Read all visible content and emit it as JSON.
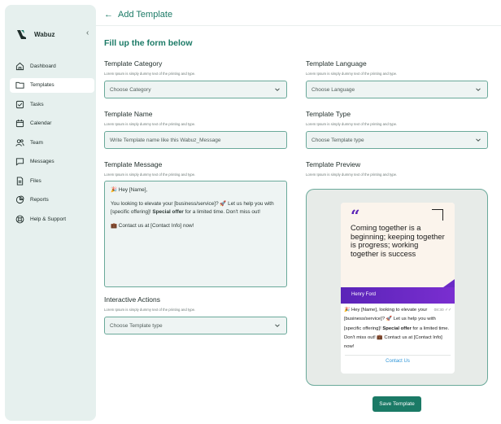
{
  "sidebar": {
    "brand": "Wabuz",
    "collapse_icon": "chevron-left-icon",
    "items": [
      {
        "label": "Dashboard",
        "icon": "home-icon"
      },
      {
        "label": "Templates",
        "icon": "folder-icon",
        "active": true
      },
      {
        "label": "Tasks",
        "icon": "checkbox-icon"
      },
      {
        "label": "Calendar",
        "icon": "calendar-icon"
      },
      {
        "label": "Team",
        "icon": "users-icon"
      },
      {
        "label": "Messages",
        "icon": "message-icon"
      },
      {
        "label": "Files",
        "icon": "file-icon"
      },
      {
        "label": "Reports",
        "icon": "pie-chart-icon"
      },
      {
        "label": "Help & Support",
        "icon": "lifebuoy-icon"
      }
    ]
  },
  "header": {
    "back_arrow": "←",
    "title": "Add Template"
  },
  "form": {
    "title": "Fill up the form below",
    "helper": "Lorem Ipsum is simply dummy text of the printing and type.",
    "category": {
      "label": "Template Category",
      "placeholder": "Choose Category"
    },
    "language": {
      "label": "Template Language",
      "placeholder": "Choose Language"
    },
    "name": {
      "label": "Template Name",
      "placeholder": "Write Template name like this Wabuz_Message"
    },
    "type": {
      "label": "Template Type",
      "placeholder": "Choose Template type"
    },
    "message": {
      "label": "Template Message",
      "line1": "🎉 Hey [Name],",
      "line2a": "You looking to elevate your [business/service]? 🚀 Let us help you with [specific offering]! ",
      "line2b": "Special offer",
      "line2c": " for a limited time. Don't miss out!",
      "line3": "💼 Contact us at [Contact Info] now!"
    },
    "preview": {
      "label": "Template Preview",
      "quote_mark": "“",
      "quote": "Coming together is a beginning; keeping together is progress; working together is success",
      "author": "Henry Ford",
      "msg_a": "🎉 Hey [Name], looking to elevate your [business/service]? 🚀 Let us help you with [specific offering]! ",
      "msg_b": "Special offer",
      "msg_c": " for a limited time. Don't miss out! 💼 Contact us at [Contact Info] now!",
      "time": "08:30 ✓✓",
      "contact": "Contact Us"
    },
    "actions": {
      "label": "Interactive Actions",
      "placeholder": "Choose Template type"
    },
    "save_label": "Save Template"
  },
  "colors": {
    "accent": "#1b7a66",
    "sidebar_bg": "#e6f0ee",
    "field_bg": "#eef4f3",
    "field_border": "#6aa99a",
    "quote_purple": "#5a24b8"
  }
}
